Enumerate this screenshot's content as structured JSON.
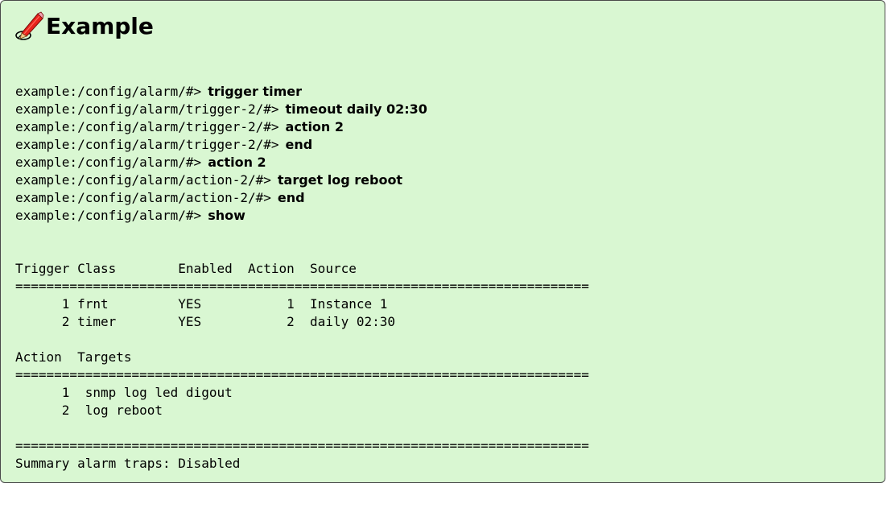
{
  "header": {
    "title": "Example",
    "icon": "pencil-icon"
  },
  "commands": [
    {
      "prompt": "example:/config/alarm/#>",
      "command": "trigger timer"
    },
    {
      "prompt": "example:/config/alarm/trigger-2/#>",
      "command": "timeout daily 02:30"
    },
    {
      "prompt": "example:/config/alarm/trigger-2/#>",
      "command": "action 2"
    },
    {
      "prompt": "example:/config/alarm/trigger-2/#>",
      "command": "end"
    },
    {
      "prompt": "example:/config/alarm/#>",
      "command": "action 2"
    },
    {
      "prompt": "example:/config/alarm/action-2/#>",
      "command": "target log reboot"
    },
    {
      "prompt": "example:/config/alarm/action-2/#>",
      "command": "end"
    },
    {
      "prompt": "example:/config/alarm/#>",
      "command": "show"
    }
  ],
  "output": [
    "Trigger Class        Enabled  Action  Source",
    "==========================================================================",
    "      1 frnt         YES           1  Instance 1",
    "      2 timer        YES           2  daily 02:30",
    "",
    "Action  Targets",
    "==========================================================================",
    "      1  snmp log led digout",
    "      2  log reboot",
    "",
    "==========================================================================",
    "Summary alarm traps: Disabled"
  ]
}
